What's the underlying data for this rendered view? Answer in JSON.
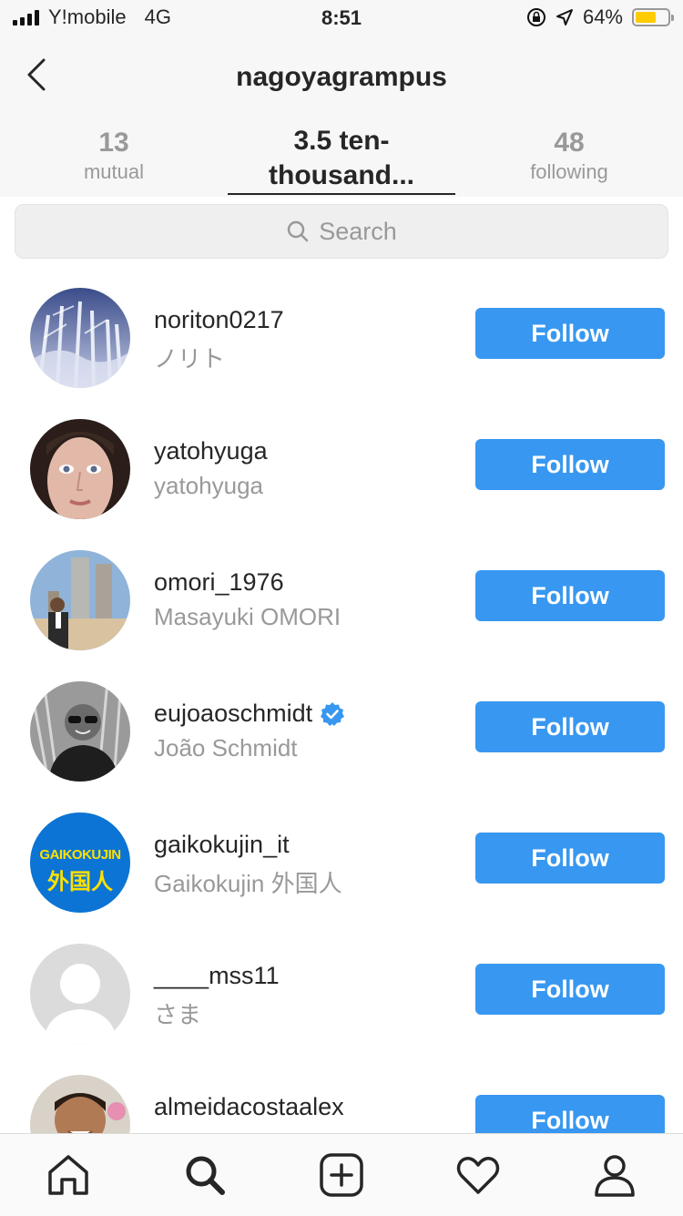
{
  "status_bar": {
    "carrier": "Y!mobile",
    "network": "4G",
    "time": "8:51",
    "battery": "64%",
    "battery_level": 0.64
  },
  "header": {
    "title": "nagoyagrampus",
    "tabs": [
      {
        "count": "13",
        "label": "mutual"
      },
      {
        "line1": "3.5 ten-",
        "line2": "thousand..."
      },
      {
        "count": "48",
        "label": "following"
      }
    ]
  },
  "search": {
    "placeholder": "Search"
  },
  "rows": [
    {
      "username": "noriton0217",
      "fullname": "ノリト",
      "button": "Follow",
      "verified": false
    },
    {
      "username": "yatohyuga",
      "fullname": "yatohyuga",
      "button": "Follow",
      "verified": false
    },
    {
      "username": "omori_1976",
      "fullname": "Masayuki OMORI",
      "button": "Follow",
      "verified": false
    },
    {
      "username": "eujoaoschmidt",
      "fullname": "João Schmidt",
      "button": "Follow",
      "verified": true
    },
    {
      "username": "gaikokujin_it",
      "fullname": "Gaikokujin 外国人",
      "button": "Follow",
      "verified": false,
      "avatar_text_1": "GAIKOKUJIN",
      "avatar_text_2": "外国人"
    },
    {
      "username": "____mss11",
      "fullname": "さま",
      "button": "Follow",
      "verified": false
    },
    {
      "username": "almeidacostaalex",
      "fullname": "",
      "button": "Follow",
      "verified": false
    }
  ],
  "colors": {
    "accent": "#3897f0",
    "verified": "#3897f0"
  },
  "bottom_nav": [
    "home-icon",
    "search-icon",
    "add-post-icon",
    "activity-heart-icon",
    "profile-icon"
  ]
}
